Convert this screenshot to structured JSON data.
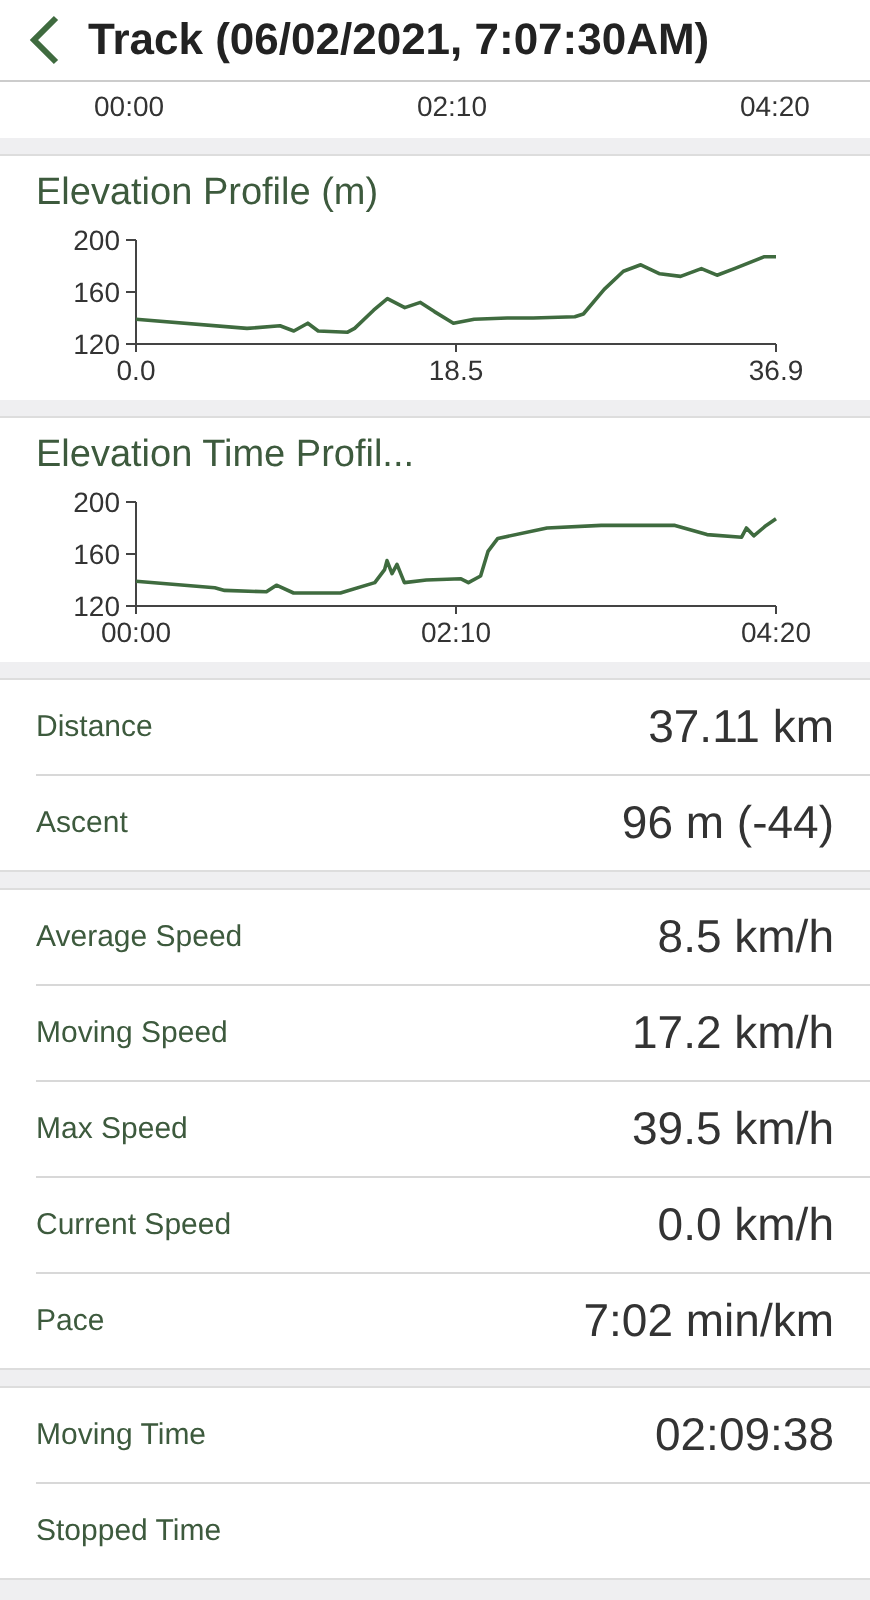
{
  "header": {
    "title": "Track (06/02/2021, 7:07:30AM)"
  },
  "top_chart_axis": {
    "labels": [
      "00:00",
      "02:10",
      "04:20"
    ]
  },
  "charts": [
    {
      "title": "Elevation Profile (m)",
      "chart_data": {
        "type": "line",
        "x": [
          0,
          6.4,
          8.3,
          9.1,
          9.9,
          10.5,
          12.2,
          12.6,
          13.7,
          14.5,
          15.5,
          16.4,
          17.2,
          18.3,
          19.5,
          21.4,
          22.9,
          25.3,
          25.8,
          27.0,
          28.1,
          29.1,
          30.2,
          31.4,
          32.6,
          33.5,
          34.5,
          36.2,
          36.9
        ],
        "series": [
          {
            "color": "#3f6b3f",
            "values": [
              139,
              132,
              134,
              130,
              136,
              130,
              129,
              132,
              146,
              155,
              148,
              152,
              145,
              136,
              139,
              140,
              140,
              141,
              143,
              162,
              176,
              181,
              174,
              172,
              178,
              173,
              178,
              187,
              187
            ]
          }
        ],
        "xlim": [
          0,
          36.9
        ],
        "ylim": [
          120,
          200
        ],
        "xticks": [
          {
            "value": 0,
            "label": "0.0"
          },
          {
            "value": 18.45,
            "label": "18.5"
          },
          {
            "value": 36.9,
            "label": "36.9"
          }
        ],
        "yticks": [
          120,
          160,
          200
        ]
      }
    },
    {
      "title": "Elevation Time Profil...",
      "chart_data": {
        "type": "line",
        "x": [
          0,
          32,
          36,
          53,
          57,
          64,
          83,
          97,
          101,
          102,
          104,
          106,
          109,
          118,
          132,
          135,
          140,
          143,
          147,
          167,
          189,
          219,
          232,
          246,
          248,
          251,
          256,
          260
        ],
        "series": [
          {
            "color": "#3f6b3f",
            "values": [
              139,
              134,
              132,
              131,
              136,
              130,
              130,
              138,
              148,
              155,
              145,
              152,
              138,
              140,
              141,
              138,
              143,
              162,
              172,
              180,
              182,
              182,
              175,
              173,
              180,
              174,
              182,
              187
            ]
          }
        ],
        "xlim": [
          0,
          260
        ],
        "ylim": [
          120,
          200
        ],
        "xticks": [
          {
            "value": 0,
            "label": "00:00"
          },
          {
            "value": 130,
            "label": "02:10"
          },
          {
            "value": 260,
            "label": "04:20"
          }
        ],
        "yticks": [
          120,
          160,
          200
        ]
      }
    }
  ],
  "stat_groups": [
    [
      {
        "label": "Distance",
        "value": "37.11 km"
      },
      {
        "label": "Ascent",
        "value": "96 m (-44)"
      }
    ],
    [
      {
        "label": "Average Speed",
        "value": "8.5 km/h"
      },
      {
        "label": "Moving Speed",
        "value": "17.2 km/h"
      },
      {
        "label": "Max Speed",
        "value": "39.5 km/h"
      },
      {
        "label": "Current Speed",
        "value": "0.0 km/h"
      },
      {
        "label": "Pace",
        "value": "7:02 min/km"
      }
    ],
    [
      {
        "label": "Moving Time",
        "value": "02:09:38"
      },
      {
        "label": "Stopped Time"
      }
    ]
  ]
}
